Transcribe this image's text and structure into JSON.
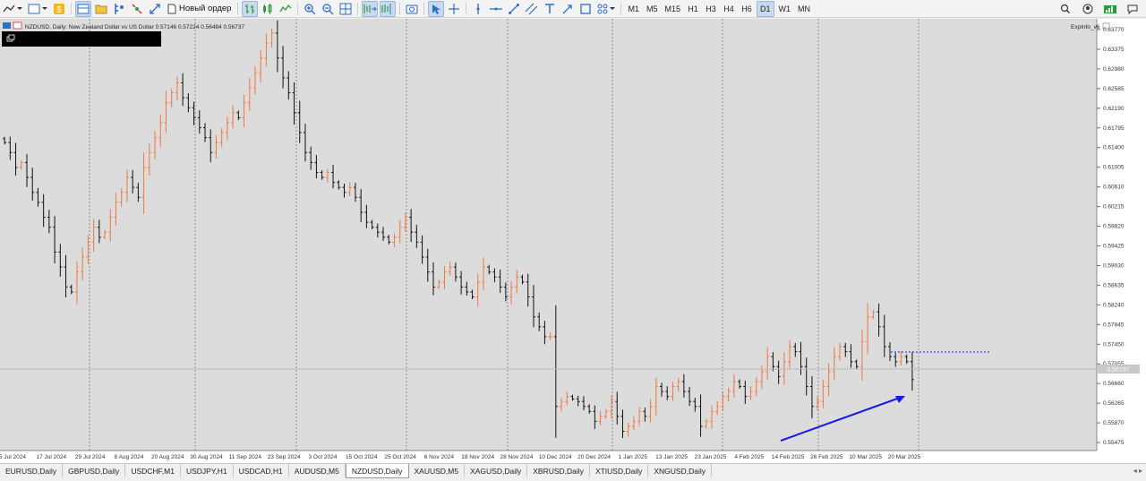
{
  "toolbar": {
    "new_order_label": "Новый ордер",
    "timeframes": [
      "M1",
      "M5",
      "M15",
      "H1",
      "H3",
      "H4",
      "H6",
      "D1",
      "W1",
      "MN"
    ],
    "active_timeframe": "D1"
  },
  "chart": {
    "title": "NZDUSD, Daily:  New Zealand Dollar vs US Dollar  0.57146 0.57224 0.56484 0.56737",
    "indicator_label": "ExpInfo_v6",
    "bull_color": "#f07840",
    "bear_color": "#111111",
    "background": "#dcdcdc",
    "arrow_color": "#1a1ae6",
    "current_price_label": "0.56737"
  },
  "chart_data": {
    "type": "candlestick",
    "symbol": "NZDUSD",
    "timeframe": "Daily",
    "price_ticks": [
      "0.63770",
      "0.63375",
      "0.62980",
      "0.62585",
      "0.62190",
      "0.61795",
      "0.61400",
      "0.61005",
      "0.60610",
      "0.60215",
      "0.59820",
      "0.59425",
      "0.59030",
      "0.58635",
      "0.58240",
      "0.57845",
      "0.57450",
      "0.57055",
      "0.56660",
      "0.56265",
      "0.55870",
      "0.55475"
    ],
    "date_ticks": [
      "5 Jul 2024",
      "17 Jul 2024",
      "29 Jul 2024",
      "8 Aug 2024",
      "20 Aug 2024",
      "30 Aug 2024",
      "11 Sep 2024",
      "23 Sep 2024",
      "3 Oct 2024",
      "15 Oct 2024",
      "25 Oct 2024",
      "6 Nov 2024",
      "18 Nov 2024",
      "28 Nov 2024",
      "10 Dec 2024",
      "20 Dec 2024",
      "1 Jan 2025",
      "13 Jan 2025",
      "23 Jan 2025",
      "4 Feb 2025",
      "14 Feb 2025",
      "26 Feb 2025",
      "10 Mar 2025",
      "20 Mar 2025"
    ],
    "ylim": [
      0.5535,
      0.6395
    ],
    "closes": [
      0.615,
      0.613,
      0.61,
      0.611,
      0.608,
      0.605,
      0.603,
      0.6,
      0.598,
      0.593,
      0.59,
      0.586,
      0.585,
      0.589,
      0.592,
      0.595,
      0.598,
      0.596,
      0.597,
      0.6,
      0.603,
      0.605,
      0.608,
      0.606,
      0.604,
      0.61,
      0.613,
      0.616,
      0.619,
      0.623,
      0.625,
      0.627,
      0.624,
      0.622,
      0.62,
      0.618,
      0.616,
      0.613,
      0.615,
      0.617,
      0.619,
      0.621,
      0.62,
      0.623,
      0.626,
      0.629,
      0.632,
      0.635,
      0.637,
      0.632,
      0.628,
      0.625,
      0.621,
      0.617,
      0.613,
      0.611,
      0.609,
      0.608,
      0.609,
      0.607,
      0.606,
      0.605,
      0.606,
      0.604,
      0.601,
      0.599,
      0.598,
      0.597,
      0.596,
      0.595,
      0.596,
      0.598,
      0.6,
      0.597,
      0.595,
      0.592,
      0.589,
      0.586,
      0.587,
      0.589,
      0.59,
      0.588,
      0.586,
      0.585,
      0.584,
      0.587,
      0.59,
      0.589,
      0.588,
      0.586,
      0.584,
      0.586,
      0.588,
      0.587,
      0.584,
      0.58,
      0.578,
      0.576,
      0.576,
      0.562,
      0.563,
      0.564,
      0.5635,
      0.563,
      0.562,
      0.561,
      0.559,
      0.56,
      0.561,
      0.563,
      0.56,
      0.557,
      0.558,
      0.559,
      0.561,
      0.56,
      0.562,
      0.566,
      0.565,
      0.564,
      0.566,
      0.567,
      0.565,
      0.563,
      0.562,
      0.558,
      0.559,
      0.561,
      0.562,
      0.564,
      0.565,
      0.567,
      0.566,
      0.564,
      0.565,
      0.567,
      0.569,
      0.572,
      0.57,
      0.568,
      0.571,
      0.574,
      0.573,
      0.57,
      0.566,
      0.562,
      0.563,
      0.566,
      0.569,
      0.572,
      0.574,
      0.573,
      0.571,
      0.57,
      0.575,
      0.58,
      0.581,
      0.578,
      0.574,
      0.572,
      0.571,
      0.572,
      0.571,
      0.5674
    ]
  },
  "tabs": [
    "EURUSD,Daily",
    "GBPUSD,Daily",
    "USDCHF,M1",
    "USDJPY,H1",
    "USDCAD,H1",
    "AUDUSD,M5",
    "NZDUSD,Daily",
    "XAUUSD,M5",
    "XAGUSD,Daily",
    "XBRUSD,Daily",
    "XTIUSD,Daily",
    "XNGUSD,Daily"
  ],
  "active_tab": "NZDUSD,Daily"
}
